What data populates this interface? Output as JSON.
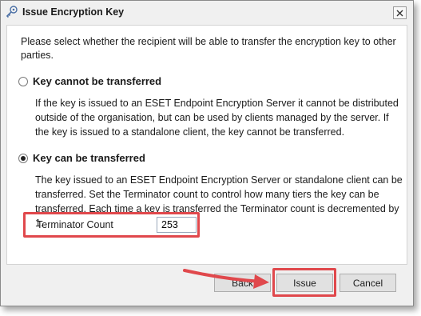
{
  "dialog": {
    "title": "Issue Encryption Key",
    "intro": "Please select whether the recipient will be able to transfer the encryption key to other parties."
  },
  "options": [
    {
      "label": "Key cannot be transferred",
      "checked": false,
      "description": "If the key is issued to an ESET Endpoint Encryption Server it cannot be distributed outside of the organisation, but can be used by clients managed by the server. If the key is issued to a standalone client, the key cannot be transferred."
    },
    {
      "label": "Key can be transferred",
      "checked": true,
      "description": "The key issued to an ESET Endpoint Encryption Server or standalone client can be transferred. Set the Terminator count to control how many tiers the key can be transferred. Each time a key is transferred the Terminator count is decremented by 1."
    }
  ],
  "terminator": {
    "label": "Terminator Count",
    "value": "253"
  },
  "buttons": {
    "back": "Back",
    "issue": "Issue",
    "cancel": "Cancel"
  },
  "colors": {
    "highlight": "#e0484c"
  }
}
